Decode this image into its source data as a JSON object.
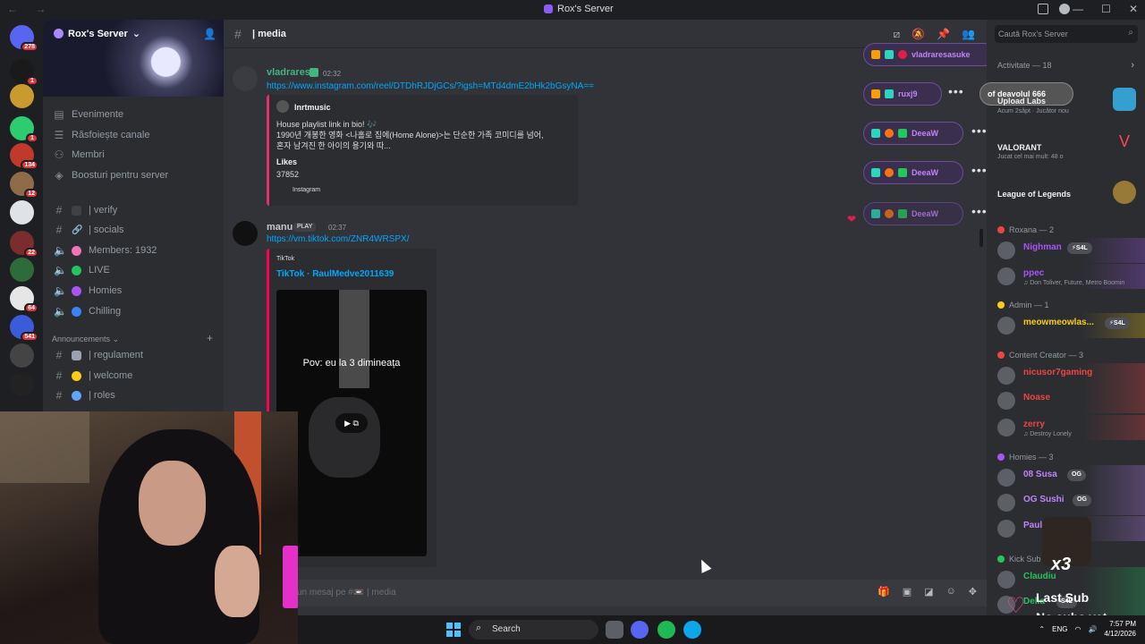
{
  "window": {
    "title": "Rox's Server",
    "nav_arrows": "← →",
    "controls": [
      "—",
      "☐",
      "✕"
    ]
  },
  "rail": {
    "servers": [
      {
        "name": "discord-home",
        "badge": "278",
        "color": "#5865f2"
      },
      {
        "name": "server-w",
        "badge": "1",
        "color": "#1a1a1a"
      },
      {
        "name": "server-gold",
        "badge": "",
        "color": "#c99a2e"
      },
      {
        "name": "server-green",
        "badge": "1",
        "color": "#2ecc71"
      },
      {
        "name": "server-pink",
        "badge": "134",
        "color": "#c0392b"
      },
      {
        "name": "server-anime",
        "badge": "12",
        "color": "#8e6c4a"
      },
      {
        "name": "server-white",
        "badge": "",
        "color": "#dfe3e8"
      },
      {
        "name": "server-red",
        "badge": "22",
        "color": "#7b2d2d"
      },
      {
        "name": "server-forest",
        "badge": "",
        "color": "#2f6b3a"
      },
      {
        "name": "server-char",
        "badge": "64",
        "color": "#e6e6e6"
      },
      {
        "name": "server-blue",
        "badge": "541",
        "color": "#3b5bdb"
      },
      {
        "name": "server-x",
        "badge": "",
        "color": "#444"
      },
      {
        "name": "server-w2g",
        "badge": "",
        "color": "#222"
      }
    ]
  },
  "sidebar": {
    "server_name": "Rox's Server",
    "menu": [
      {
        "icon": "calendar-icon",
        "label": "Evenimente"
      },
      {
        "icon": "browse-icon",
        "label": "Răsfoiește canale"
      },
      {
        "icon": "members-icon",
        "label": "Membri"
      },
      {
        "icon": "boost-icon",
        "label": "Boosturi pentru server"
      }
    ],
    "channels": [
      {
        "kind": "text",
        "label": "| verify",
        "emoji_color": ""
      },
      {
        "kind": "text",
        "label": "| socials",
        "emoji_color": ""
      },
      {
        "kind": "voice",
        "label": "Members: 1932",
        "emoji_color": "#f472b6"
      },
      {
        "kind": "voice",
        "label": "LIVE",
        "emoji_color": "#22c55e"
      },
      {
        "kind": "voice",
        "label": "Homies",
        "emoji_color": "#a855f7"
      },
      {
        "kind": "voice",
        "label": "Chilling",
        "emoji_color": "#3b82f6"
      }
    ],
    "category": "Announcements",
    "category_channels": [
      {
        "label": "| regulament",
        "emoji_color": "#9ca3af"
      },
      {
        "label": "| welcome",
        "emoji_color": "#facc15"
      },
      {
        "label": "| roles",
        "emoji_color": "#60a5fa"
      }
    ]
  },
  "channel": {
    "name": "| media",
    "search_placeholder": "Caută Rox's Server"
  },
  "messages": [
    {
      "author": "vladrares",
      "author_color": "#43b581",
      "time": "02:32",
      "link": "https://www.instagram.com/reel/DTDhRJDjGCs/?igsh=MTd4dmE2bHk2bGsyNA==",
      "embed": {
        "author": "lnrtmusic",
        "description": "House playlist link in bio! 🎶\n1990년 개봉한 영화 <나홀로 집에(Home Alone)>는 단순한 가족 코미디를 넘어,\n혼자 남겨진 한 아이의 용기와 따...",
        "field_name": "Likes",
        "field_value": "37852",
        "footer": "Instagram"
      }
    },
    {
      "author": "manu",
      "author_color": "#c4c9ce",
      "tag": "PLAY",
      "time": "02:37",
      "link": "https://vm.tiktok.com/ZNR4WRSPX/",
      "embed": {
        "provider": "TikTok",
        "title": "TikTok · RaulMedve2011639",
        "video_caption": "Pov: eu la 3 dimineața"
      }
    }
  ],
  "overlay_reactions": [
    {
      "name": "vladraresasuke"
    },
    {
      "name": "ruxj9"
    },
    {
      "name": "DeeaW"
    },
    {
      "name": "DeeaW"
    },
    {
      "name": "DeeaW"
    }
  ],
  "composer": {
    "placeholder": "un mesaj pe #📼 | media"
  },
  "activity": {
    "title": "Activitate",
    "count": "18",
    "items": [
      {
        "name": "of deavolul 666",
        "game": "Upload Labs",
        "sub": "Acum 2săpt · Jucător nou"
      },
      {
        "name": "",
        "game": "VALORANT",
        "sub": "Jucat cel mai mult: 48 o"
      },
      {
        "name": "",
        "game": "League of Legends",
        "sub": ""
      }
    ]
  },
  "member_groups": [
    {
      "label": "Roxana — 2",
      "icon_color": "#ef4444",
      "members": [
        {
          "name": "Nighman",
          "color": "#a855f7",
          "tag": "⚡S4L",
          "status": ""
        },
        {
          "name": "ppec",
          "color": "#a855f7",
          "tag": "",
          "status": "♫ Don Toliver, Future, Metro Boomin"
        }
      ]
    },
    {
      "label": "Admin — 1",
      "icon_color": "#facc15",
      "members": [
        {
          "name": "meowmeowlas...",
          "color": "#facc15",
          "tag": "⚡S4L",
          "status": ""
        }
      ]
    },
    {
      "label": "Content Creator — 3",
      "icon_color": "#ef4444",
      "members": [
        {
          "name": "nicusor7gaming",
          "color": "#ef4444",
          "tag": "",
          "status": ""
        },
        {
          "name": "Noase",
          "color": "#ef4444",
          "tag": "",
          "status": ""
        },
        {
          "name": "zerry",
          "color": "#ef4444",
          "tag": "",
          "status": "♫ Destroy Lonely"
        }
      ]
    },
    {
      "label": "Homies — 3",
      "icon_color": "#a855f7",
      "members": [
        {
          "name": "08 Susa",
          "color": "#c084fc",
          "tag": "OG",
          "status": ""
        },
        {
          "name": "OG Sushi",
          "color": "#c084fc",
          "tag": "OG",
          "status": ""
        },
        {
          "name": "Paul",
          "color": "#c084fc",
          "tag": "",
          "status": ""
        }
      ]
    },
    {
      "label": "Kick Sub",
      "icon_color": "#22c55e",
      "members": [
        {
          "name": "Claudiu",
          "color": "#22c55e",
          "tag": "",
          "status": ""
        },
        {
          "name": "Delia",
          "color": "#22c55e",
          "tag": "S4L",
          "status": ""
        }
      ]
    }
  ],
  "stream_overlay": {
    "multiplier": "x3",
    "last_sub_label": "Last Sub",
    "last_sub_value": "No subs yet"
  },
  "taskbar": {
    "search_label": "Search",
    "lang": "ENG",
    "time": "7:57 PM",
    "date": "4/12/2026"
  }
}
